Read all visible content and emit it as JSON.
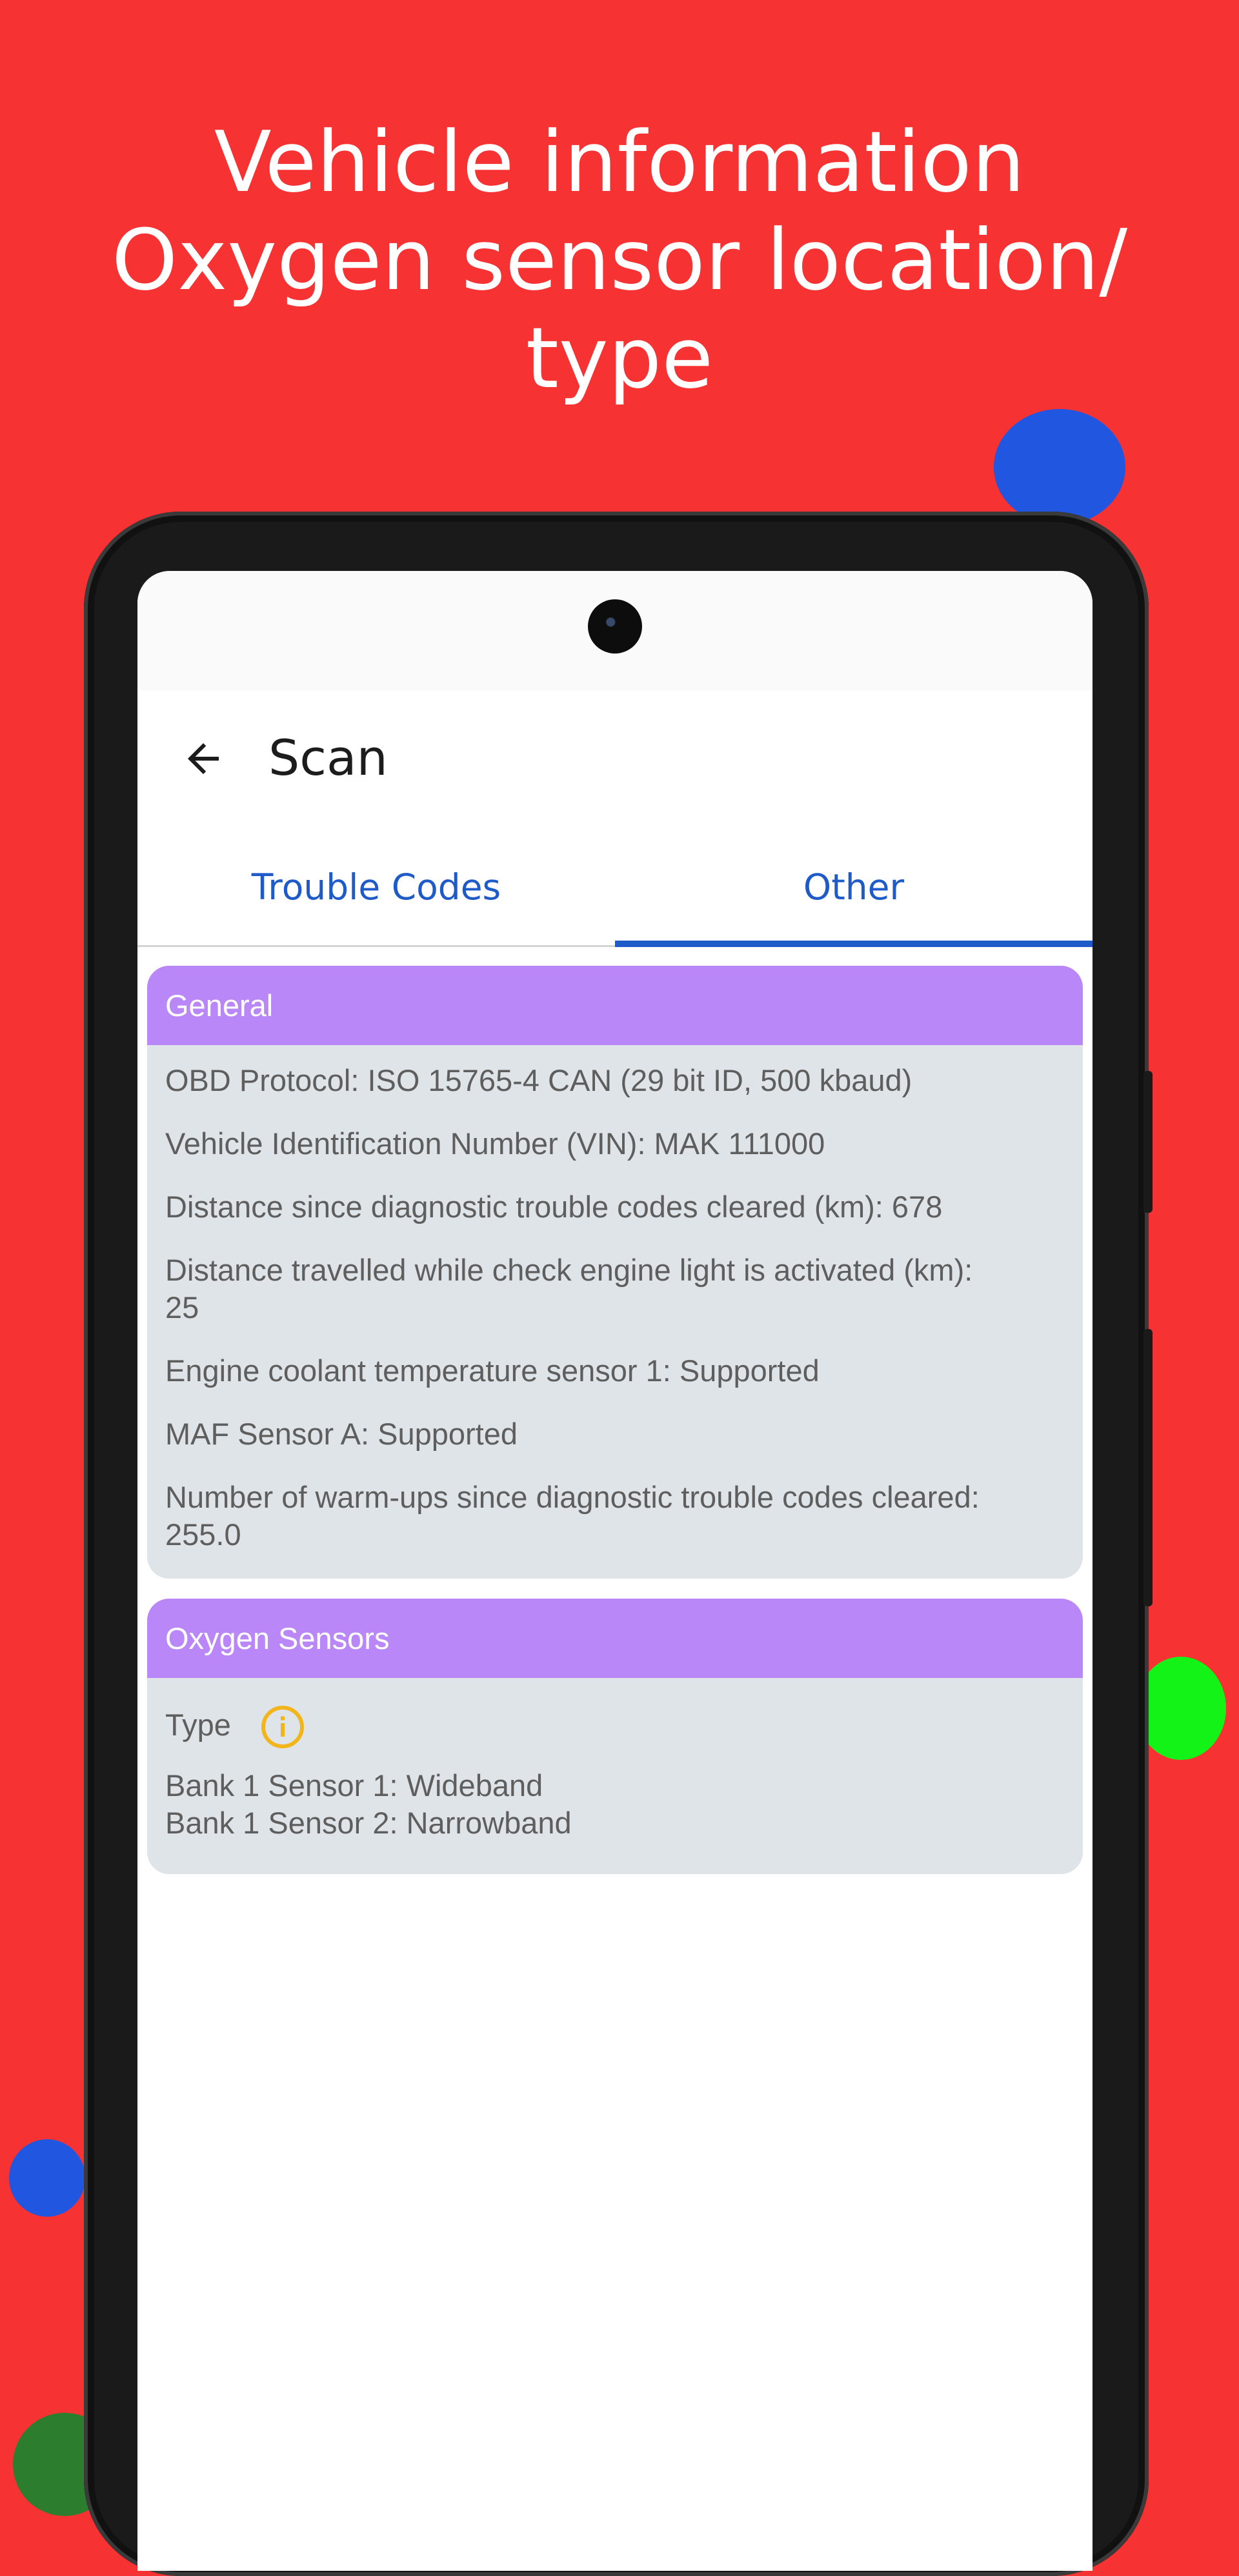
{
  "headline": {
    "line1": "Vehicle information",
    "line2": "Oxygen sensor location/",
    "line3": "type"
  },
  "appbar": {
    "title": "Scan",
    "back_icon": "arrow-left-icon"
  },
  "tabs": [
    {
      "label": "Trouble Codes",
      "selected": false
    },
    {
      "label": "Other",
      "selected": true
    }
  ],
  "general": {
    "header": "General",
    "items": [
      "OBD Protocol: ISO 15765-4 CAN (29 bit ID, 500 kbaud)",
      "Vehicle Identification Number (VIN): MAK 111000",
      "Distance since diagnostic trouble codes cleared (km): 678",
      "Distance travelled while check engine light is activated (km):",
      "25",
      "Engine coolant temperature sensor 1: Supported",
      "MAF Sensor A: Supported",
      "Number of warm-ups since diagnostic trouble codes cleared:",
      "255.0"
    ]
  },
  "oxygen": {
    "header": "Oxygen Sensors",
    "type_label": "Type",
    "info_icon": "info-circle-icon",
    "sensors": [
      "Bank 1 Sensor 1: Wideband",
      "Bank 1 Sensor 2: Narrowband"
    ]
  },
  "colors": {
    "background": "#f73233",
    "accent": "#1e5ac8",
    "card_header": "#ba87f8",
    "card_body": "#dfe4e8",
    "info_icon": "#f2b51c"
  }
}
